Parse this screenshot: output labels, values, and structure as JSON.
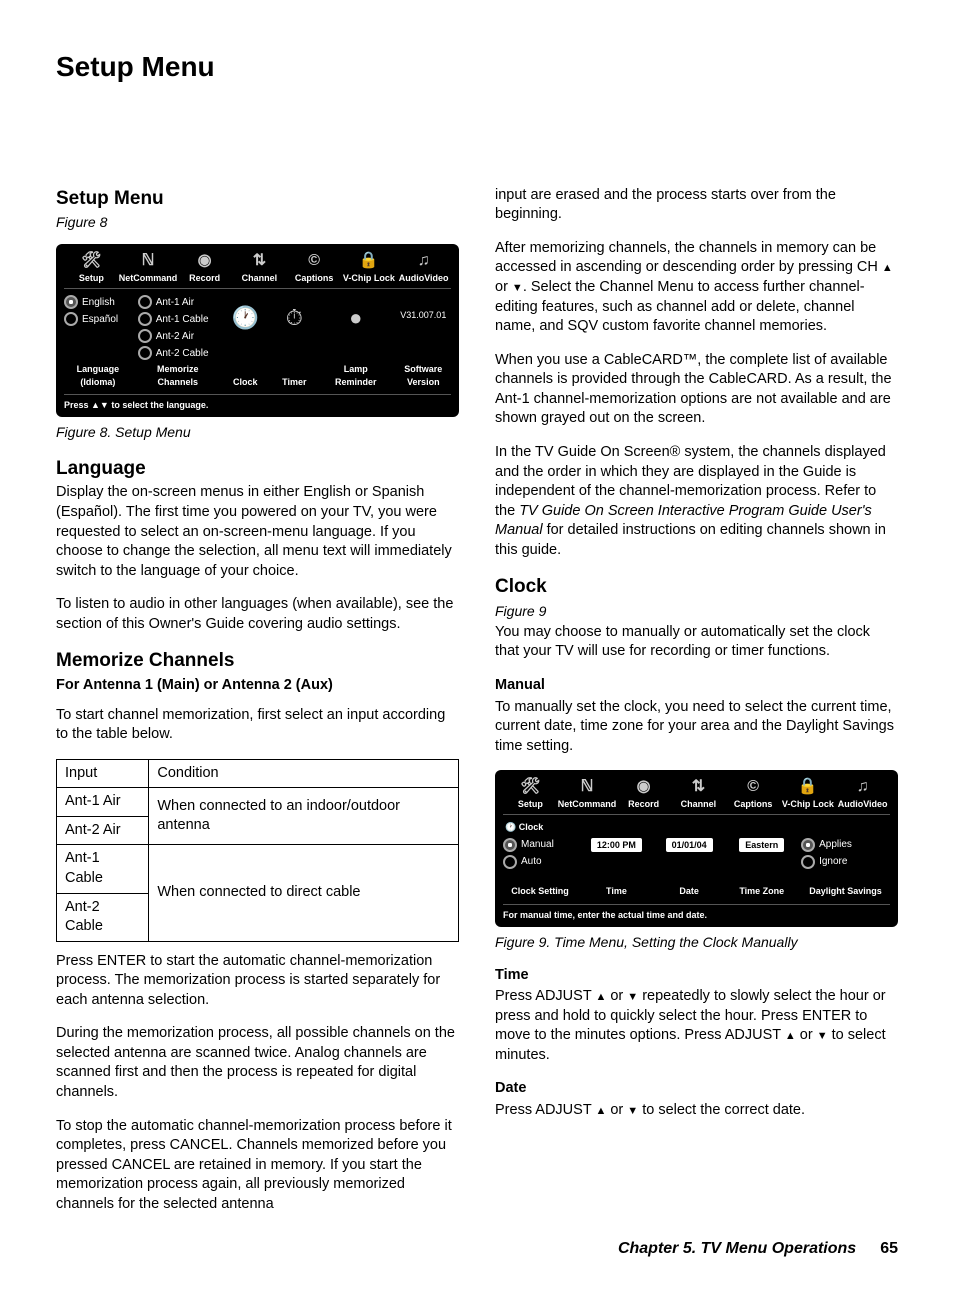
{
  "page_title": "Setup Menu",
  "left": {
    "h_setup": "Setup Menu",
    "fig8_ref": "Figure 8",
    "fig8_caption": "Figure 8. Setup Menu",
    "h_language": "Language",
    "p_language_1": "Display the on-screen menus in either English or Spanish (Español).  The first time you powered on your TV, you were requested to select an on-screen-menu language.  If you choose to change the selection, all menu text will immediately switch to the language of your choice.",
    "p_language_2": "To listen to audio in other languages (when available), see the section of this Owner's Guide covering audio settings.",
    "h_memorize": "Memorize Channels",
    "sub_memorize": "For Antenna 1 (Main) or Antenna 2 (Aux)",
    "p_memorize_intro": "To start channel memorization, first select an input according to the table below.",
    "table": {
      "h_input": "Input",
      "h_cond": "Condition",
      "r1": "Ant-1 Air",
      "r2": "Ant-2 Air",
      "c12": "When connected to an indoor/outdoor antenna",
      "r3": "Ant-1 Cable",
      "r4": "Ant-2 Cable",
      "c34": "When connected to direct cable"
    },
    "p_mem_1": "Press ENTER to start the automatic channel-memorization process.  The memorization process is started separately for each antenna selection.",
    "p_mem_2": "During the memorization process, all possible channels on the selected antenna are scanned twice.  Analog channels are scanned first and then the process is repeated for digital channels.",
    "p_mem_3": "To stop the automatic channel-memorization process before it completes, press CANCEL.  Channels memorized before you pressed CANCEL are retained in memory.  If you start the memorization process again, all previously memorized channels for the selected antenna"
  },
  "right": {
    "p_cont_1": "input are erased and the process starts over from the beginning.",
    "p_cont_2a": "After memorizing channels, the channels in memory can be accessed in ascending or descending order by pressing CH ",
    "p_cont_2b": " or ",
    "p_cont_2c": ".  Select the Channel Menu to access further channel-editing features, such as channel add or delete, channel name, and SQV custom favorite channel memories.",
    "p_cont_3": "When you use a CableCARD™, the complete list of available channels is provided through the CableCARD.  As a result, the Ant-1 channel-memorization options are not available and are shown grayed out on the screen.",
    "p_cont_4a": "In the TV Guide On Screen® system, the channels displayed and the order in which they are displayed in the Guide is independent of the channel-memorization process.  Refer to the ",
    "p_cont_4b": "TV Guide On Screen Interactive Program Guide User's Manual",
    "p_cont_4c": " for detailed instructions on editing channels shown in this guide.",
    "h_clock": "Clock",
    "fig9_ref": "Figure 9",
    "p_clock_intro": "You may choose to manually or automatically set the clock that your TV will use for recording or timer functions.",
    "h_manual": "Manual",
    "p_manual": "To manually set the clock, you need to select the  current time, current date, time zone for your area and the Daylight Savings time setting.",
    "fig9_caption": "Figure 9. Time Menu, Setting the Clock Manually",
    "h_time": "Time",
    "p_time_a": "Press ADJUST ",
    "p_time_b": " or ",
    "p_time_c": " repeatedly to slowly select the hour or press and hold to quickly select the hour.  Press ENTER to move to the minutes options.  Press ADJUST ",
    "p_time_d": " or ",
    "p_time_e": " to select minutes.",
    "h_date": "Date",
    "p_date_a": "Press ADJUST ",
    "p_date_b": " or ",
    "p_date_c": " to select the correct date."
  },
  "tv1": {
    "tabs": [
      "Setup",
      "NetCommand",
      "Record",
      "Channel",
      "Captions",
      "V-Chip Lock",
      "AudioVideo"
    ],
    "lang_en": "English",
    "lang_es": "Español",
    "lang_label": "Language (Idioma)",
    "ant1a": "Ant-1 Air",
    "ant1c": "Ant-1 Cable",
    "ant2a": "Ant-2 Air",
    "ant2c": "Ant-2 Cable",
    "mem_label": "Memorize Channels",
    "clock_label": "Clock",
    "timer_label": "Timer",
    "lamp_label": "Lamp Reminder",
    "ver": "V31.007.01",
    "sw_label": "Software Version",
    "hint": "Press ▲▼ to select the language."
  },
  "tv2": {
    "tabs": [
      "Setup",
      "NetCommand",
      "Record",
      "Channel",
      "Captions",
      "V-Chip Lock",
      "AudioVideo"
    ],
    "clock": "Clock",
    "manual": "Manual",
    "auto": "Auto",
    "cs_label": "Clock Setting",
    "time_val": "12:00 PM",
    "time_label": "Time",
    "date_val": "01/01/04",
    "date_label": "Date",
    "tz_val": "Eastern",
    "tz_label": "Time Zone",
    "applies": "Applies",
    "ignore": "Ignore",
    "ds_label": "Daylight Savings",
    "hint": "For manual time, enter the actual time and date."
  },
  "footer": {
    "chapter": "Chapter 5. TV Menu Operations",
    "page": "65"
  }
}
